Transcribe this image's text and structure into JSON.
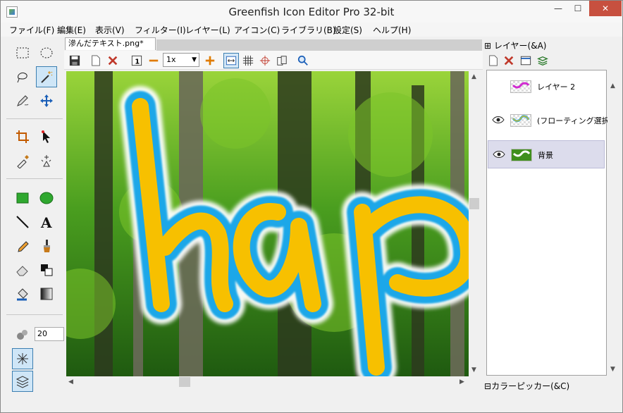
{
  "window": {
    "title": "Greenfish Icon Editor Pro 32-bit",
    "controls": {
      "minimize": "—",
      "maximize": "☐",
      "close": "✕"
    }
  },
  "menu": [
    {
      "label": "ファイル(F)"
    },
    {
      "label": "編集(E)"
    },
    {
      "label": "表示(V)"
    },
    {
      "label": "フィルター(I)"
    },
    {
      "label": "レイヤー(L)"
    },
    {
      "label": "アイコン(C)"
    },
    {
      "label": "ライブラリ(B)"
    },
    {
      "label": "設定(S)"
    },
    {
      "label": "ヘルプ(H)"
    }
  ],
  "toolbox": {
    "brush_size": "20",
    "active_tool": "magic-wand",
    "tools": [
      "rectangle-select-icon",
      "ellipse-select-icon",
      "lasso-icon",
      "magic-wand-icon",
      "pencil-icon",
      "move-icon",
      "crop-icon",
      "pointer-icon",
      "eyedropper-icon",
      "sparkle-fill-icon",
      "rectangle-icon",
      "ellipse-icon",
      "line-icon",
      "text-icon",
      "pen-icon",
      "brush-icon",
      "eraser-icon",
      "color-swap-icon",
      "paint-bucket-icon",
      "gradient-icon"
    ]
  },
  "document": {
    "tab_label": "滲んだテキスト.png*",
    "zoom": "1x",
    "canvas_text": "hap"
  },
  "colors": {
    "accent": "#3c7fb1",
    "text_fill": "#f7c000",
    "text_stroke": "#1aa7e8",
    "forest": "#3f8f1d",
    "close_button": "#c7503f"
  },
  "layers_panel": {
    "header": "レイヤー(&A)",
    "layers": [
      {
        "name": "レイヤー 2",
        "visible": false,
        "selected": false
      },
      {
        "name": "(フローティング選択)",
        "visible": true,
        "selected": false
      },
      {
        "name": "背景",
        "visible": true,
        "selected": true
      }
    ]
  },
  "color_picker_panel": {
    "header": "カラーピッカー(&C)"
  }
}
